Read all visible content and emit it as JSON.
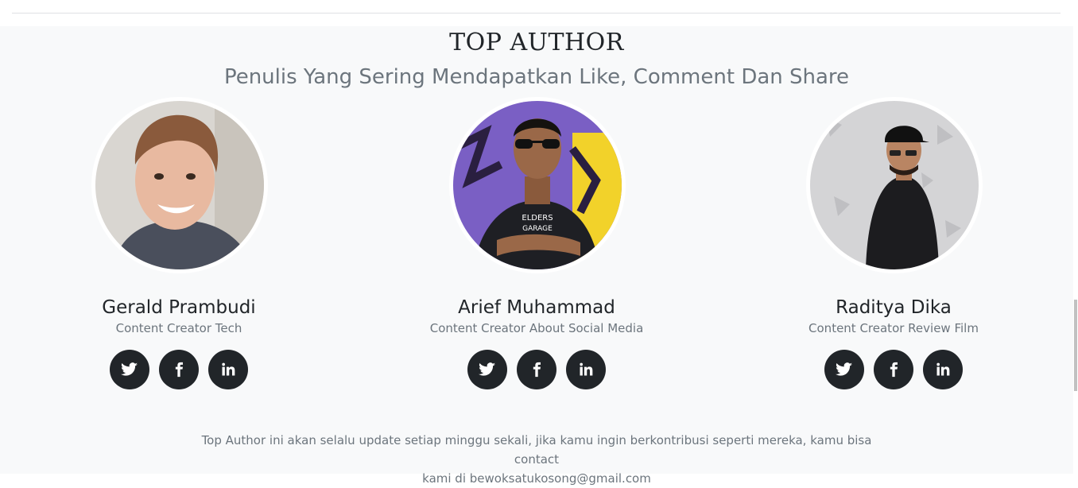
{
  "section": {
    "title": "TOP AUTHOR",
    "subtitle": "Penulis Yang Sering Mendapatkan Like, Comment Dan Share"
  },
  "authors": [
    {
      "name": "Gerald Prambudi",
      "role": "Content Creator Tech",
      "photo_icon": "portrait-photo",
      "socials": [
        "twitter-icon",
        "facebook-icon",
        "linkedin-icon"
      ]
    },
    {
      "name": "Arief Muhammad",
      "role": "Content Creator About Social Media",
      "photo_icon": "portrait-photo",
      "socials": [
        "twitter-icon",
        "facebook-icon",
        "linkedin-icon"
      ]
    },
    {
      "name": "Raditya Dika",
      "role": "Content Creator Review Film",
      "photo_icon": "portrait-photo",
      "socials": [
        "twitter-icon",
        "facebook-icon",
        "linkedin-icon"
      ]
    }
  ],
  "footer": {
    "line1": "Top Author ini akan selalu update setiap minggu sekali, jika kamu ingin berkontribusi seperti mereka, kamu bisa contact",
    "line2": "kami di bewoksatukosong@gmail.com"
  },
  "colors": {
    "section_bg": "#f8f9fa",
    "heading": "#212529",
    "muted": "#6c757d",
    "social_bg": "#212529"
  }
}
